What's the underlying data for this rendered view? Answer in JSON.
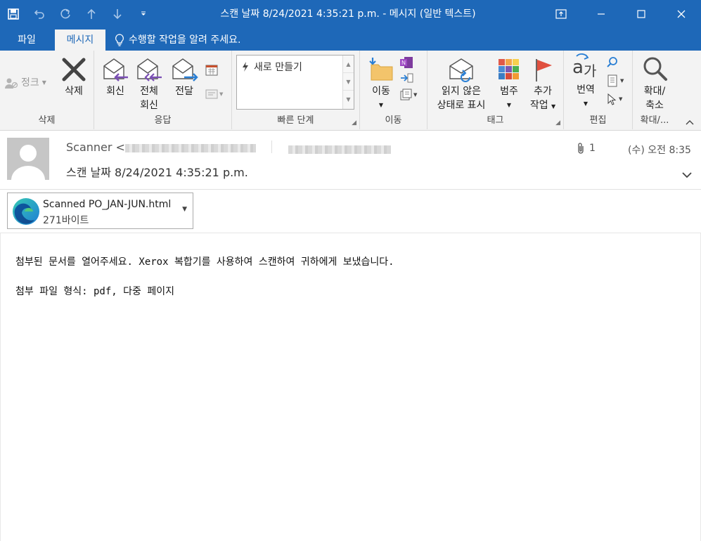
{
  "window": {
    "title": "스캔 날짜 8/24/2021 4:35:21 p.m. - 메시지 (일반 텍스트)",
    "accent_color": "#1e68b8"
  },
  "tabs": {
    "file": "파일",
    "message": "메시지",
    "tell_me": "수행할 작업을 알려 주세요."
  },
  "ribbon": {
    "delete_group": {
      "junk": "정크",
      "delete": "삭제",
      "label": "삭제"
    },
    "respond_group": {
      "reply": "회신",
      "reply_all_1": "전체",
      "reply_all_2": "회신",
      "forward": "전달",
      "label": "응답"
    },
    "quick_steps_group": {
      "new": "새로 만들기",
      "label": "빠른 단계"
    },
    "move_group": {
      "move": "이동",
      "label": "이동"
    },
    "tags_group": {
      "unread_1": "읽지 않은",
      "unread_2": "상태로 표시",
      "categorize": "범주",
      "followup_1": "추가",
      "followup_2": "작업",
      "label": "태그"
    },
    "editing_group": {
      "translate": "번역",
      "label": "편집"
    },
    "zoom_group": {
      "zoom_1": "확대/",
      "zoom_2": "축소",
      "label": "확대/..."
    }
  },
  "message": {
    "sender_name": "Scanner <",
    "subject": "스캔 날짜 8/24/2021 4:35:21 p.m.",
    "attachment_count": "1",
    "date": "(수) 오전 8:35"
  },
  "attachment": {
    "filename": "Scanned PO_JAN-JUN.html",
    "size": "271바이트"
  },
  "body": {
    "line1": "첨부된 문서를 열어주세요. Xerox 복합기를 사용하여 스캔하여 귀하에게 보냈습니다.",
    "line2": "첨부 파일 형식: pdf, 다중 페이지"
  }
}
